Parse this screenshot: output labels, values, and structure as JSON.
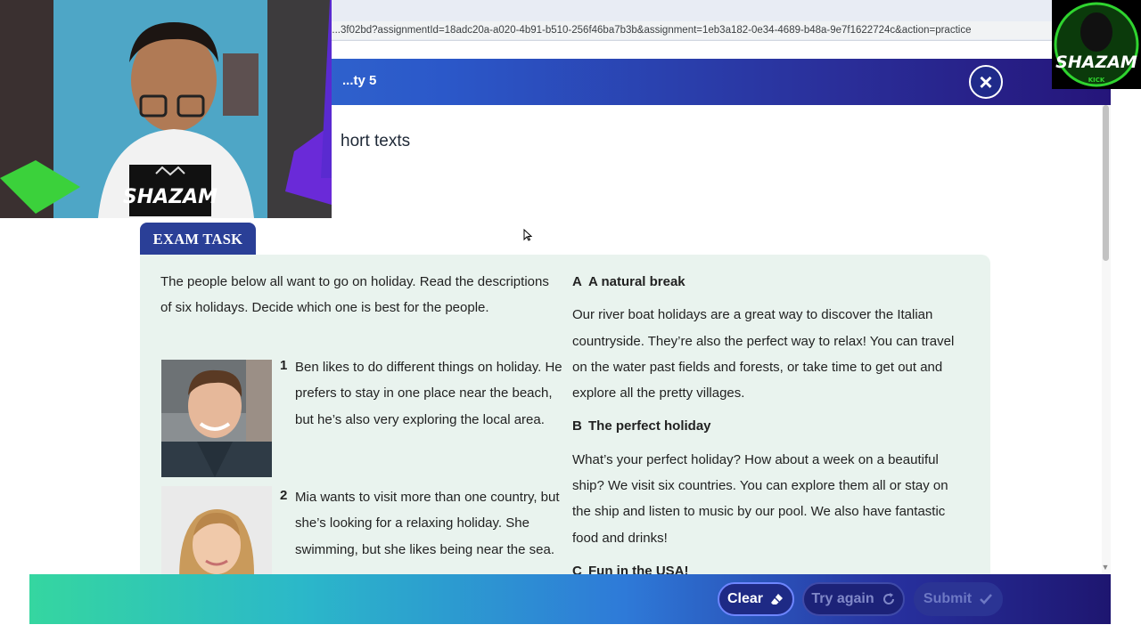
{
  "browser": {
    "url": "d...3f02bd?assignmentId=18adc20a-a020-4b91-b510-256f46ba7b3b&assignment=1eb3a182-0e34-4689-b48a-9e7f1622724c&action=practice"
  },
  "header": {
    "title": "...ty 5",
    "close_symbol": "×"
  },
  "content": {
    "subheading": "hort texts"
  },
  "exam": {
    "tab_label": "EXAM TASK",
    "instructions": "The people below all want to go on holiday. Read the descriptions of six holidays. Decide which one is best for the people.",
    "people": [
      {
        "number": "1",
        "text": "Ben likes to do different things on holiday. He prefers to stay in one place near the beach, but he’s also very exploring the local area."
      },
      {
        "number": "2",
        "text": "Mia wants to visit more than one country, but she’s looking for a relaxing holiday. She swimming, but she likes being near the sea."
      }
    ],
    "holidays": [
      {
        "letter": "A",
        "title": "A natural break",
        "text": "Our river boat holidays are a great way to discover the Italian countryside. They’re also the perfect way to relax! You can travel on the water past fields and forests, or take time to get out and explore all the pretty villages."
      },
      {
        "letter": "B",
        "title": "The perfect holiday",
        "text": "What’s your perfect holiday? How about a week on a beautiful ship? We visit six countries. You can explore them all or stay on the ship and listen to music by our pool. We also have fantastic food and drinks!"
      },
      {
        "letter": "C",
        "title": "Fun in the USA!",
        "text": ""
      }
    ]
  },
  "footer": {
    "clear_label": "Clear",
    "try_again_label": "Try again",
    "submit_label": "Submit"
  },
  "overlay": {
    "webcam_logo_text": "SHAZAM",
    "badge_text": "SHAZAM",
    "badge_subtext": "KICK"
  },
  "colors": {
    "header_start": "#3a7bd5",
    "header_end": "#25157a",
    "exam_tab": "#2a3f97",
    "panel_bg": "#e9f3ee",
    "footer_start": "#35d6a0",
    "footer_end": "#1e1670"
  }
}
